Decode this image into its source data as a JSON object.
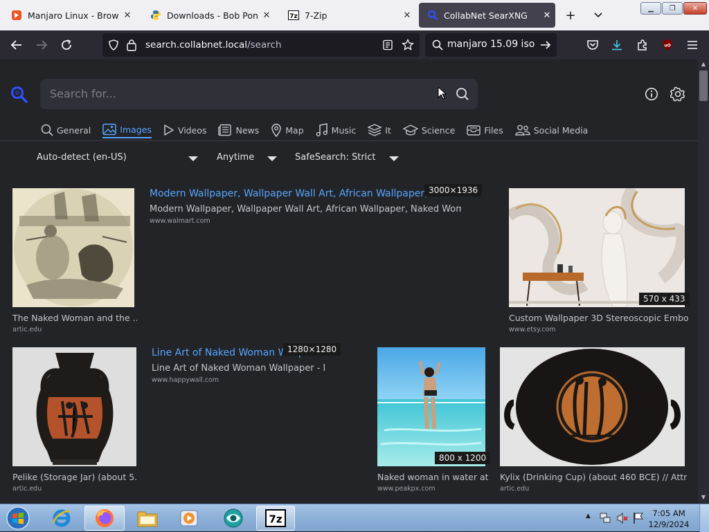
{
  "browser": {
    "tabs": [
      {
        "title": "Manjaro Linux - Browse /kd",
        "active": false
      },
      {
        "title": "Downloads - Bob Pony",
        "active": false
      },
      {
        "title": "7-Zip",
        "active": false
      },
      {
        "title": "CollabNet SearXNG",
        "active": true
      }
    ],
    "url_host": "search.collabnet.local",
    "url_path": "/search",
    "search_query": "manjaro 15.09 iso"
  },
  "page": {
    "search_placeholder": "Search for...",
    "categories": [
      "General",
      "Images",
      "Videos",
      "News",
      "Map",
      "Music",
      "It",
      "Science",
      "Files",
      "Social Media"
    ],
    "active_category": "Images",
    "filters": {
      "language": "Auto-detect (en-US)",
      "time": "Anytime",
      "safesearch": "SafeSearch: Strict"
    },
    "results": [
      {
        "caption": "The Naked Woman and the ...",
        "source": "artic.edu"
      },
      {
        "title": "Modern Wallpaper, Wallpaper Wall Art, African Wallpaper, Naked Woman",
        "description": "Modern Wallpaper, Wallpaper Wall Art, African Wallpaper, Naked Woman ...",
        "source": "www.walmart.com",
        "dimensions": "3000×1936"
      },
      {
        "caption": "Custom Wallpaper 3D Stereoscopic Embo...",
        "source": "www.etsy.com",
        "dimensions": "570 x 433"
      },
      {
        "caption": "Pelike (Storage Jar) (about 5...",
        "source": "artic.edu"
      },
      {
        "title": "Line Art of Naked Woman Wallpaper",
        "description": "Line Art of Naked Woman Wallpaper - H...",
        "source": "www.happywall.com",
        "dimensions": "1280×1280"
      },
      {
        "caption": "Naked woman in water at...",
        "source": "www.peakpx.com",
        "dimensions": "800 x 1200"
      },
      {
        "caption": "Kylix (Drinking Cup) (about 460 BCE) // Attr...",
        "source": "artic.edu"
      }
    ]
  },
  "taskbar": {
    "time": "7:05 AM",
    "date": "12/9/2024"
  }
}
